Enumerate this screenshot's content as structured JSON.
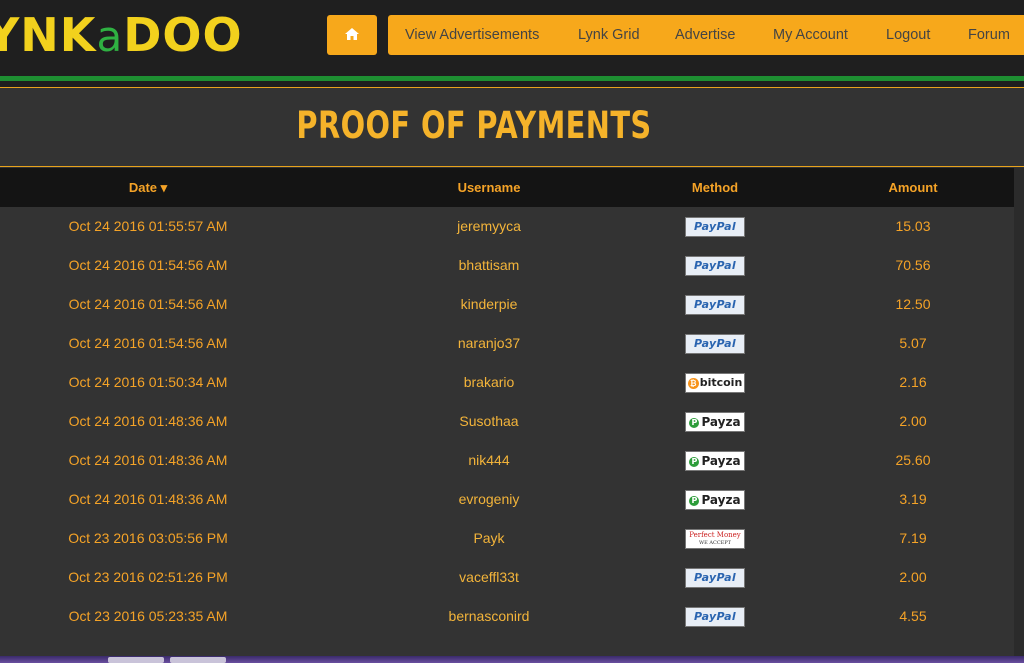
{
  "logo": {
    "part1": "YNK",
    "part2": "a",
    "part3": "DOO"
  },
  "nav": {
    "home_icon": "home-icon",
    "items": [
      "View Advertisements",
      "Lynk Grid",
      "Advertise",
      "My Account",
      "Logout",
      "Forum"
    ]
  },
  "page_title": "PROOF OF PAYMENTS",
  "table": {
    "headers": {
      "date": "Date ▾",
      "username": "Username",
      "method": "Method",
      "amount": "Amount"
    },
    "rows": [
      {
        "date": "Oct 24 2016 01:55:57 AM",
        "username": "jeremyyca",
        "method": "PayPal",
        "amount": "15.03"
      },
      {
        "date": "Oct 24 2016 01:54:56 AM",
        "username": "bhattisam",
        "method": "PayPal",
        "amount": "70.56"
      },
      {
        "date": "Oct 24 2016 01:54:56 AM",
        "username": "kinderpie",
        "method": "PayPal",
        "amount": "12.50"
      },
      {
        "date": "Oct 24 2016 01:54:56 AM",
        "username": "naranjo37",
        "method": "PayPal",
        "amount": "5.07"
      },
      {
        "date": "Oct 24 2016 01:50:34 AM",
        "username": "brakario",
        "method": "bitcoin",
        "amount": "2.16"
      },
      {
        "date": "Oct 24 2016 01:48:36 AM",
        "username": "Susothaa",
        "method": "Payza",
        "amount": "2.00"
      },
      {
        "date": "Oct 24 2016 01:48:36 AM",
        "username": "nik444",
        "method": "Payza",
        "amount": "25.60"
      },
      {
        "date": "Oct 24 2016 01:48:36 AM",
        "username": "evrogeniy",
        "method": "Payza",
        "amount": "3.19"
      },
      {
        "date": "Oct 23 2016 03:05:56 PM",
        "username": "Payk",
        "method": "Perfect Money",
        "amount": "7.19"
      },
      {
        "date": "Oct 23 2016 02:51:26 PM",
        "username": "vaceffl33t",
        "method": "PayPal",
        "amount": "2.00"
      },
      {
        "date": "Oct 23 2016 05:23:35 AM",
        "username": "bernasconird",
        "method": "PayPal",
        "amount": "4.55"
      }
    ]
  },
  "badge_text": {
    "paypal": "PayPal",
    "bitcoin": "bitcoin",
    "payza": "Payza",
    "pm_line1": "Perfect Money",
    "pm_line2": "WE ACCEPT"
  },
  "colors": {
    "accent": "#f7a81b",
    "text": "#f5a327",
    "green": "#1e8f32",
    "background": "#333333"
  }
}
